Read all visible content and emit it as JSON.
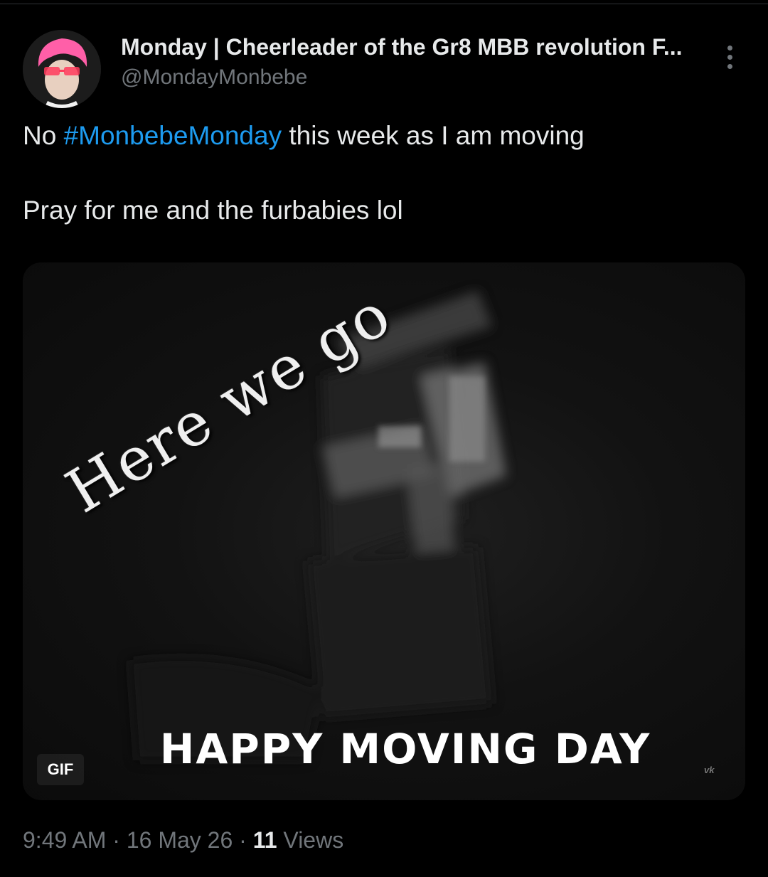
{
  "author": {
    "display_name": "Monday | Cheerleader of the Gr8 MBB revolution F...",
    "handle": "@MondayMonbebe",
    "avatar_icon": "profile-photo-pink-hair"
  },
  "tweet": {
    "line1_before": "No ",
    "hashtag": "#MonbebeMonday",
    "line1_after": " this week as I am moving",
    "line2": "Pray for me and the furbabies lol"
  },
  "media": {
    "type_badge": "GIF",
    "overlay_text": "Here we go",
    "caption": "HAPPY MOVING DAY",
    "watermark": "vk"
  },
  "meta": {
    "time": "9:49 AM",
    "separator": " · ",
    "date": "16 May 26",
    "views_count": "11",
    "views_label": " Views"
  },
  "colors": {
    "background": "#000000",
    "text": "#e7e9ea",
    "secondary": "#71767b",
    "link": "#1d9bf0"
  },
  "icons": {
    "more": "more-options-icon"
  }
}
